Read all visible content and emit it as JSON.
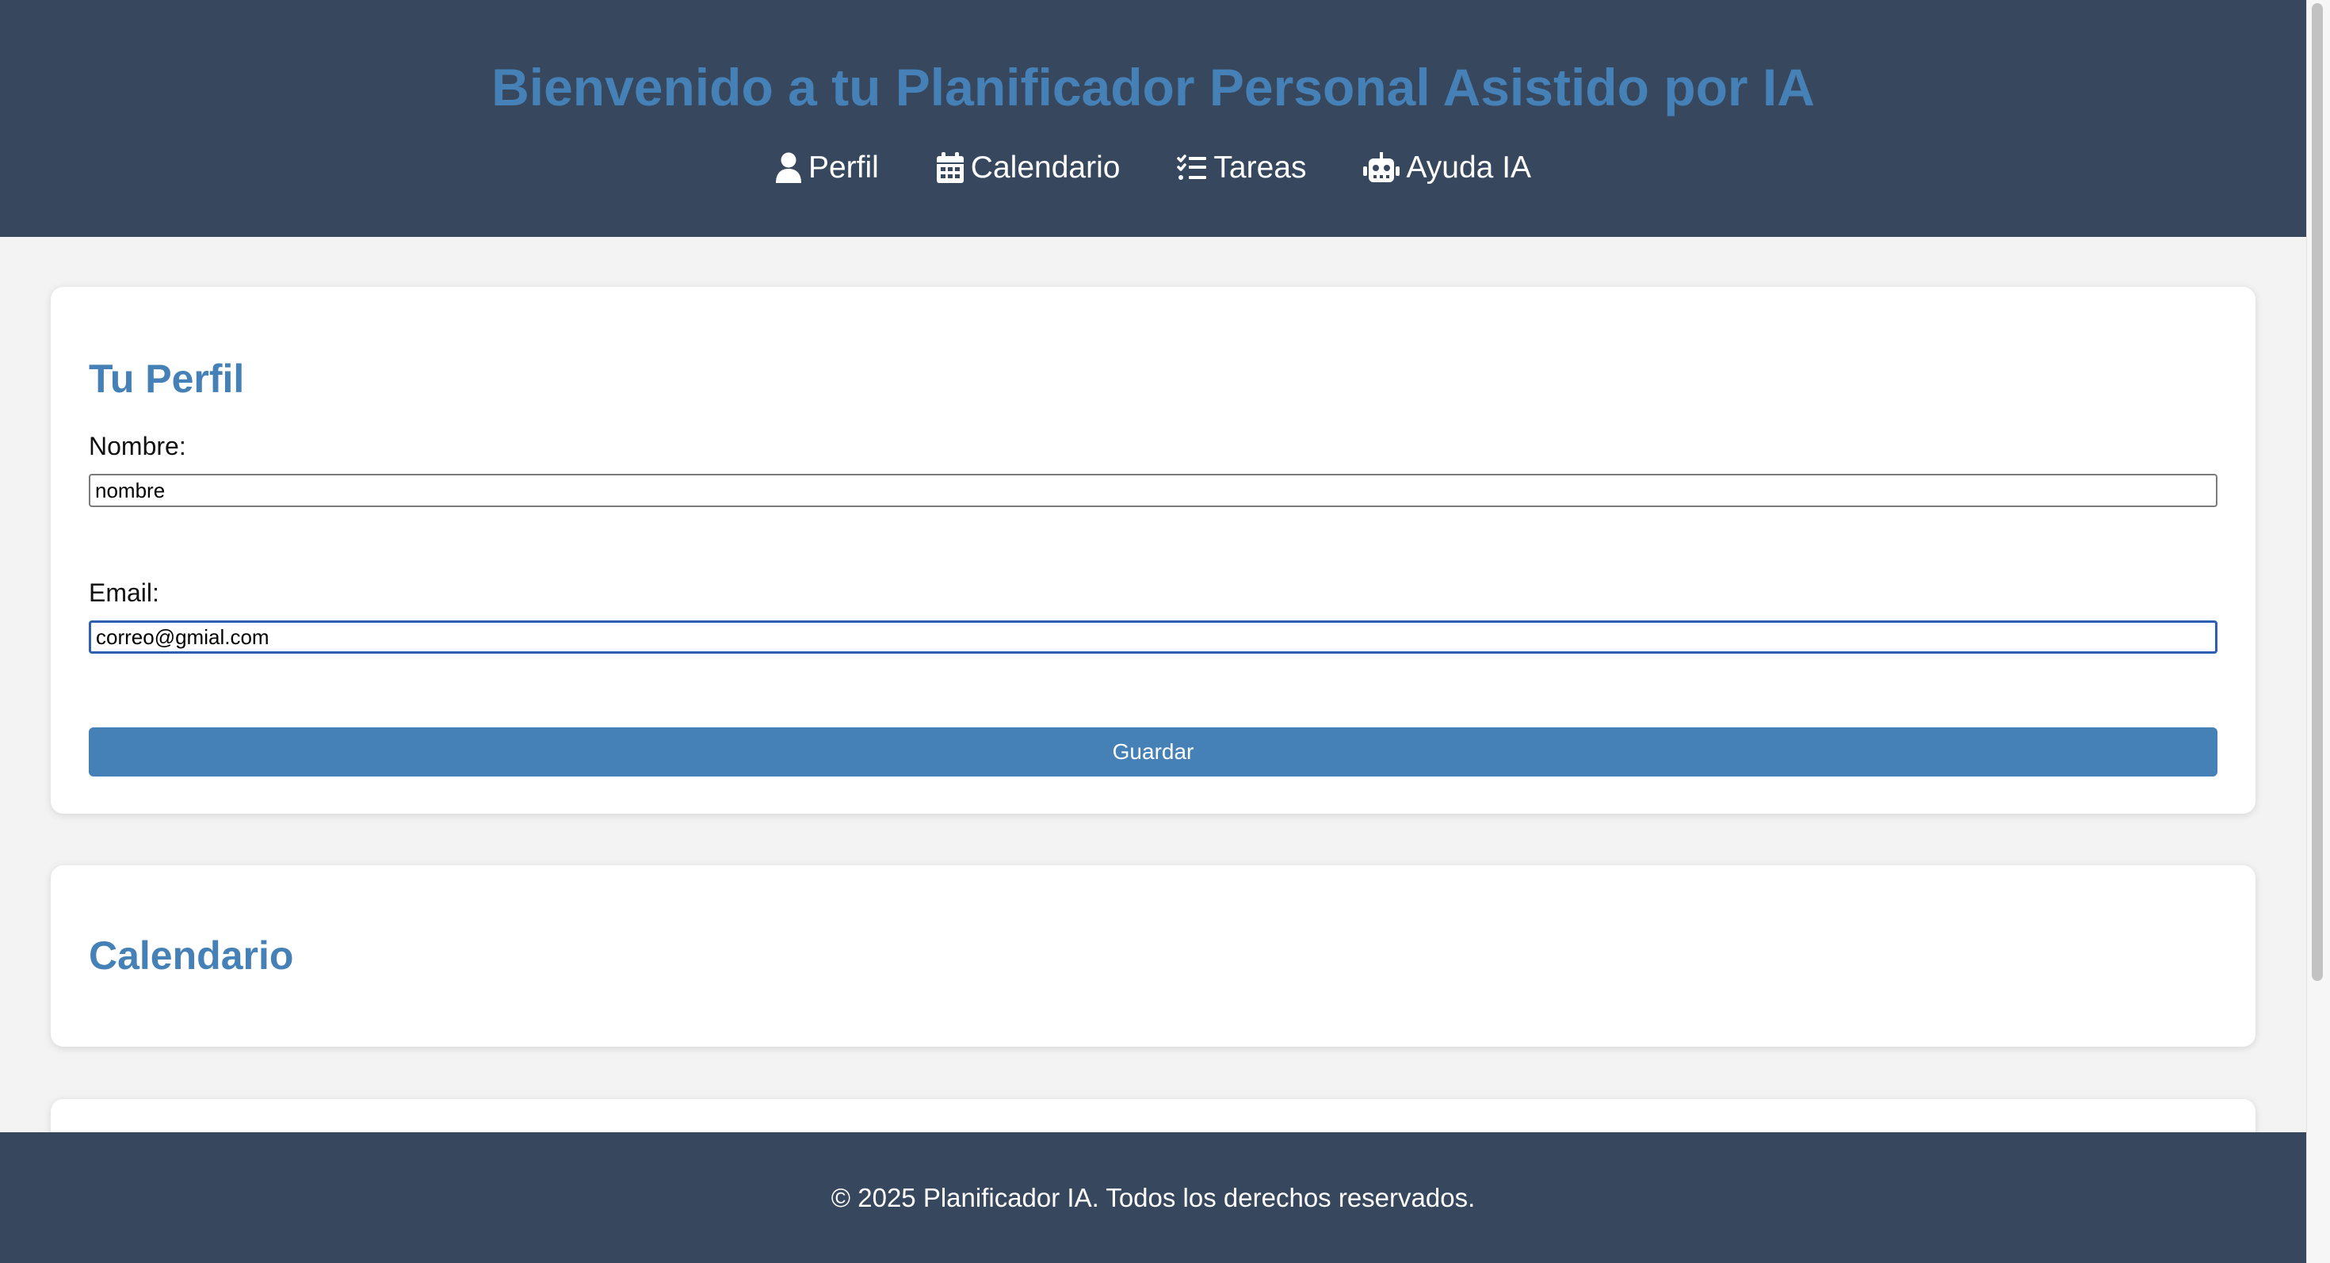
{
  "header": {
    "title": "Bienvenido a tu Planificador Personal Asistido por IA",
    "nav": [
      {
        "label": "Perfil",
        "icon": "user-icon"
      },
      {
        "label": "Calendario",
        "icon": "calendar-icon"
      },
      {
        "label": "Tareas",
        "icon": "tasks-list-icon"
      },
      {
        "label": "Ayuda IA",
        "icon": "robot-icon"
      }
    ]
  },
  "profile": {
    "heading": "Tu Perfil",
    "name_label": "Nombre:",
    "name_value": "nombre",
    "email_label": "Email:",
    "email_value": "correo@gmial.com",
    "save_label": "Guardar"
  },
  "calendar": {
    "heading": "Calendario"
  },
  "footer": {
    "text": "© 2025 Planificador IA. Todos los derechos reservados."
  },
  "colors": {
    "header_bg": "#37485e",
    "accent": "#4580b6",
    "page_bg": "#f3f3f3",
    "focus_border": "#2f5fb0"
  }
}
